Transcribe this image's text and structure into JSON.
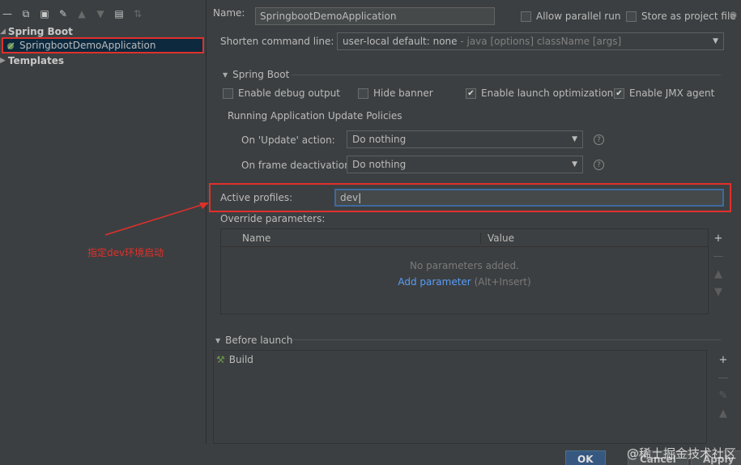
{
  "toolbar": {
    "icons": [
      "minus-icon",
      "copy-icon",
      "save-icon",
      "wrench-icon",
      "arrow-up-icon",
      "arrow-down-icon",
      "folder-add-icon",
      "sort-icon"
    ]
  },
  "tree": {
    "group_spring": "Spring Boot",
    "item_app": "SpringbootDemoApplication",
    "group_templates": "Templates"
  },
  "config": {
    "name_label": "Name:",
    "name_value": "SpringbootDemoApplication",
    "allow_parallel": "Allow parallel run",
    "store_project": "Store as project file",
    "shorten_label": "Shorten command line:",
    "shorten_value": "user-local default: none",
    "shorten_hint": " - java [options] className [args]"
  },
  "spring_boot": {
    "section_title": "Spring Boot",
    "debug_output": "Enable debug output",
    "hide_banner": "Hide banner",
    "launch_opt": "Enable launch optimization",
    "jmx_agent": "Enable JMX agent",
    "policies_title": "Running Application Update Policies",
    "on_update_label": "On 'Update' action:",
    "on_update_value": "Do nothing",
    "on_frame_label": "On frame deactivation:",
    "on_frame_value": "Do nothing",
    "active_profiles_label": "Active profiles:",
    "active_profiles_value": "dev",
    "override_label": "Override parameters:",
    "col_name": "Name",
    "col_value": "Value",
    "no_params": "No parameters added.",
    "add_param": "Add parameter",
    "add_param_hint": " (Alt+Insert)"
  },
  "before_launch": {
    "title": "Before launch",
    "build": "Build"
  },
  "buttons": {
    "ok": "OK",
    "cancel": "Cancel",
    "apply": "Apply"
  },
  "annotation": {
    "text": "指定dev环境启动"
  },
  "watermark": "@稀土掘金技术社区",
  "colors": {
    "highlight": "#e0302b",
    "link": "#589df6",
    "selection": "#0d293e"
  }
}
